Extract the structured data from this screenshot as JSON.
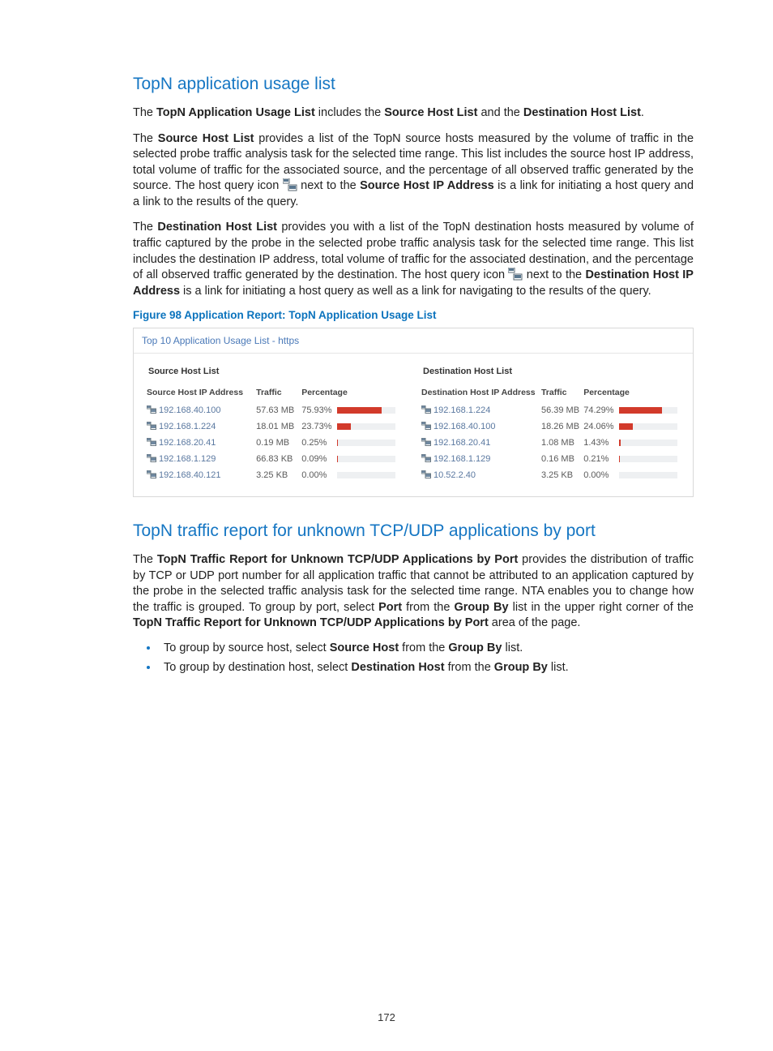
{
  "page_number": "172",
  "section1": {
    "heading": "TopN application usage list",
    "p1": {
      "pre": "The ",
      "b1": "TopN Application Usage List",
      "mid1": " includes the ",
      "b2": "Source Host List",
      "mid2": " and the ",
      "b3": "Destination Host List",
      "post": "."
    },
    "p2": {
      "pre": "The ",
      "b1": "Source Host List",
      "mid": " provides a list of the TopN source hosts measured by the volume of traffic in the selected probe traffic analysis task for the selected time range. This list includes the source host IP address, total volume of traffic for the associated source, and the percentage of all observed traffic generated by the source. The host query icon ",
      "b2": "Source Host IP Address",
      "post": " is a link for initiating a host query and a link to the results of the query.",
      "iconpre": " next to the "
    },
    "p3": {
      "pre": "The ",
      "b1": "Destination Host List",
      "mid": " provides you with a list of the TopN destination hosts measured by volume of traffic captured by the probe in the selected probe traffic analysis task for the selected time range. This list includes the destination IP address, total volume of traffic for the associated destination, and the percentage of all observed traffic generated by the destination. The host query icon ",
      "b2": "Destination Host IP Address",
      "post": " is a link for initiating a host query as well as a link for navigating to the results of the query.",
      "iconpre": " next to the "
    }
  },
  "figure": {
    "caption": "Figure 98 Application Report: TopN Application Usage List",
    "title": "Top 10 Application Usage List - https",
    "left": {
      "title": "Source Host List",
      "headers": [
        "Source Host IP Address",
        "Traffic",
        "Percentage"
      ],
      "rows": [
        {
          "ip": "192.168.40.100",
          "traffic": "57.63 MB",
          "pct": "75.93%",
          "bar": 76
        },
        {
          "ip": "192.168.1.224",
          "traffic": "18.01 MB",
          "pct": "23.73%",
          "bar": 24
        },
        {
          "ip": "192.168.20.41",
          "traffic": "0.19 MB",
          "pct": "0.25%",
          "bar": 1
        },
        {
          "ip": "192.168.1.129",
          "traffic": "66.83 KB",
          "pct": "0.09%",
          "bar": 1
        },
        {
          "ip": "192.168.40.121",
          "traffic": "3.25 KB",
          "pct": "0.00%",
          "bar": 0
        }
      ]
    },
    "right": {
      "title": "Destination Host List",
      "headers": [
        "Destination Host IP Address",
        "Traffic",
        "Percentage"
      ],
      "rows": [
        {
          "ip": "192.168.1.224",
          "traffic": "56.39 MB",
          "pct": "74.29%",
          "bar": 74
        },
        {
          "ip": "192.168.40.100",
          "traffic": "18.26 MB",
          "pct": "24.06%",
          "bar": 24
        },
        {
          "ip": "192.168.20.41",
          "traffic": "1.08 MB",
          "pct": "1.43%",
          "bar": 2
        },
        {
          "ip": "192.168.1.129",
          "traffic": "0.16 MB",
          "pct": "0.21%",
          "bar": 1
        },
        {
          "ip": "10.52.2.40",
          "traffic": "3.25 KB",
          "pct": "0.00%",
          "bar": 0
        }
      ]
    }
  },
  "section2": {
    "heading": "TopN traffic report for unknown TCP/UDP applications by port",
    "p1": {
      "pre": "The ",
      "b1": "TopN Traffic Report for Unknown TCP/UDP Applications by Port",
      "mid1": " provides the distribution of traffic by TCP or UDP port number for all application traffic that cannot be attributed to an application captured by the probe in the selected traffic analysis task for the selected time range. NTA enables you to change how the traffic is grouped. To group by port, select ",
      "b2": "Port",
      "mid2": " from the ",
      "b3": "Group By",
      "mid3": " list in the upper right corner of the ",
      "b4": "TopN Traffic Report for Unknown TCP/UDP Applications by Port",
      "post": " area of the page."
    },
    "bullets": [
      {
        "pre": "To group by source host, select ",
        "b1": "Source Host",
        "mid": " from the ",
        "b2": "Group By",
        "post": " list."
      },
      {
        "pre": "To group by destination host, select ",
        "b1": "Destination Host",
        "mid": " from the ",
        "b2": "Group By",
        "post": " list."
      }
    ]
  }
}
